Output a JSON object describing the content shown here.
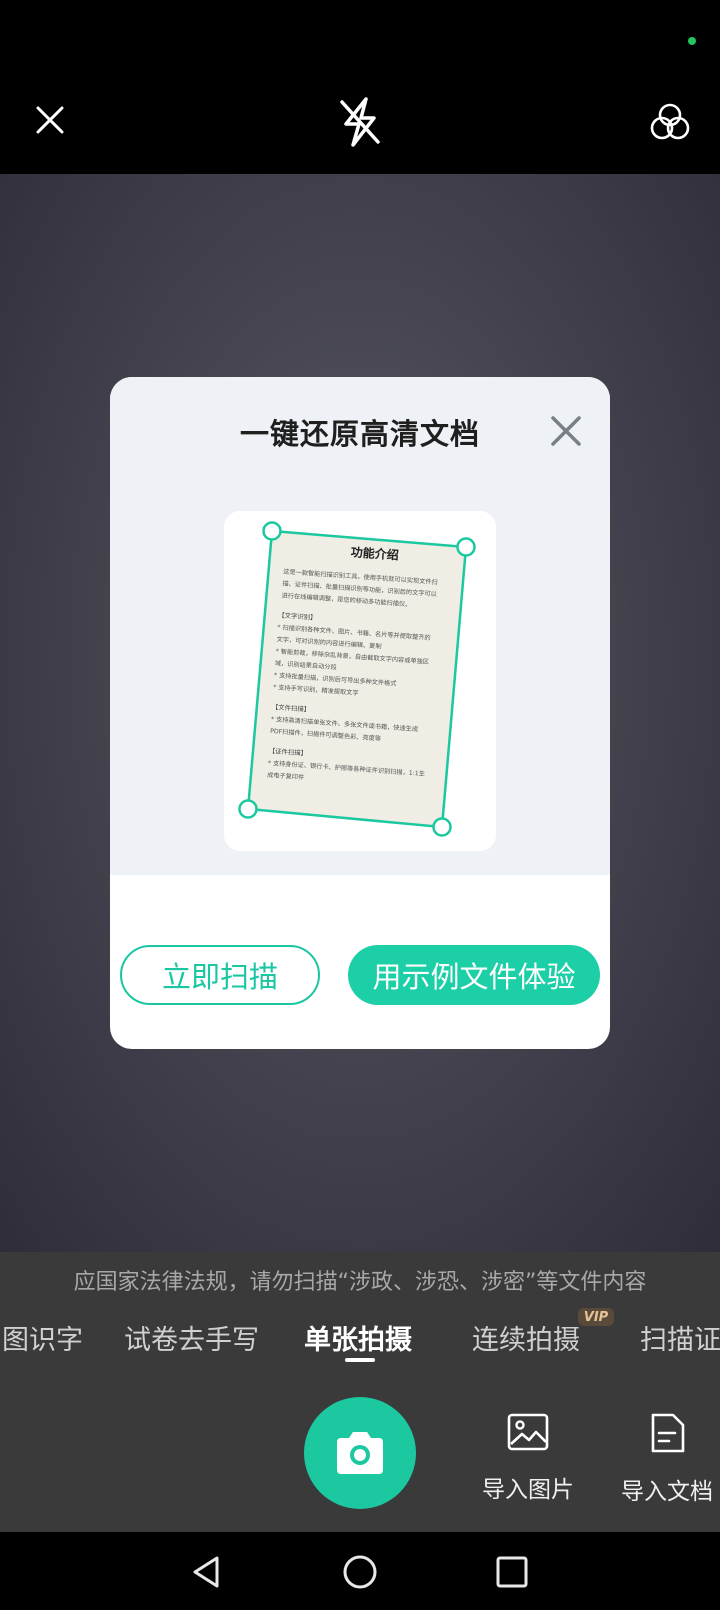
{
  "topbar": {
    "close_icon": "close-icon",
    "flash_icon": "flash-auto-icon",
    "filter_icon": "filter-icon"
  },
  "modal": {
    "title": "一键还原高清文档",
    "close_icon": "close-icon",
    "sample_doc": {
      "heading": "功能介绍",
      "intro": [
        "这是一款智能扫描识别工具，使用手机就可以实现文件扫",
        "描、证件扫描、批量扫描识别等功能，识别后的文字可以",
        "进行在线编辑调整，是您的移动多功能扫描仪。"
      ],
      "sections": [
        {
          "title": "【文字识别】",
          "lines": [
            "* 扫描识别各种文件、图片、书籍、名片等并提取整齐的",
            "文字，可对识别的内容进行编辑、复制",
            "* 智能剪裁，移除杂乱背景，自由截取文字内容或单独区",
            "域，识别结果自动分段",
            "* 支持批量扫描，识别后可导出多种文件格式",
            "* 支持手写识别，精准提取文字"
          ]
        },
        {
          "title": "【文件扫描】",
          "lines": [
            "* 支持高清扫描单张文件、多张文件或书籍，快速生成",
            "PDF扫描件，扫描件可调整色彩、亮度等"
          ]
        },
        {
          "title": "【证件扫描】",
          "lines": [
            "* 支持身份证、银行卡、护照等各种证件识别扫描，1:1生",
            "成电子复印件"
          ]
        }
      ]
    },
    "scan_now_label": "立即扫描",
    "try_sample_label": "用示例文件体验"
  },
  "notice": "应国家法律法规，请勿扫描“涉政、涉恐、涉密”等文件内容",
  "modes": [
    {
      "label": "图识字"
    },
    {
      "label": "试卷去手写"
    },
    {
      "label": "单张拍摄",
      "active": true
    },
    {
      "label": "连续拍摄",
      "badge": "VIP"
    },
    {
      "label": "扫描证"
    }
  ],
  "shutter_icon": "camera-icon",
  "imports": [
    {
      "label": "导入图片",
      "icon": "image-icon"
    },
    {
      "label": "导入文档",
      "icon": "document-icon"
    }
  ],
  "navbar": {
    "back_icon": "back-icon",
    "home_icon": "home-icon",
    "recents_icon": "recents-icon"
  },
  "colors": {
    "accent": "#1ccfa6",
    "status_dot": "#22c55e"
  }
}
